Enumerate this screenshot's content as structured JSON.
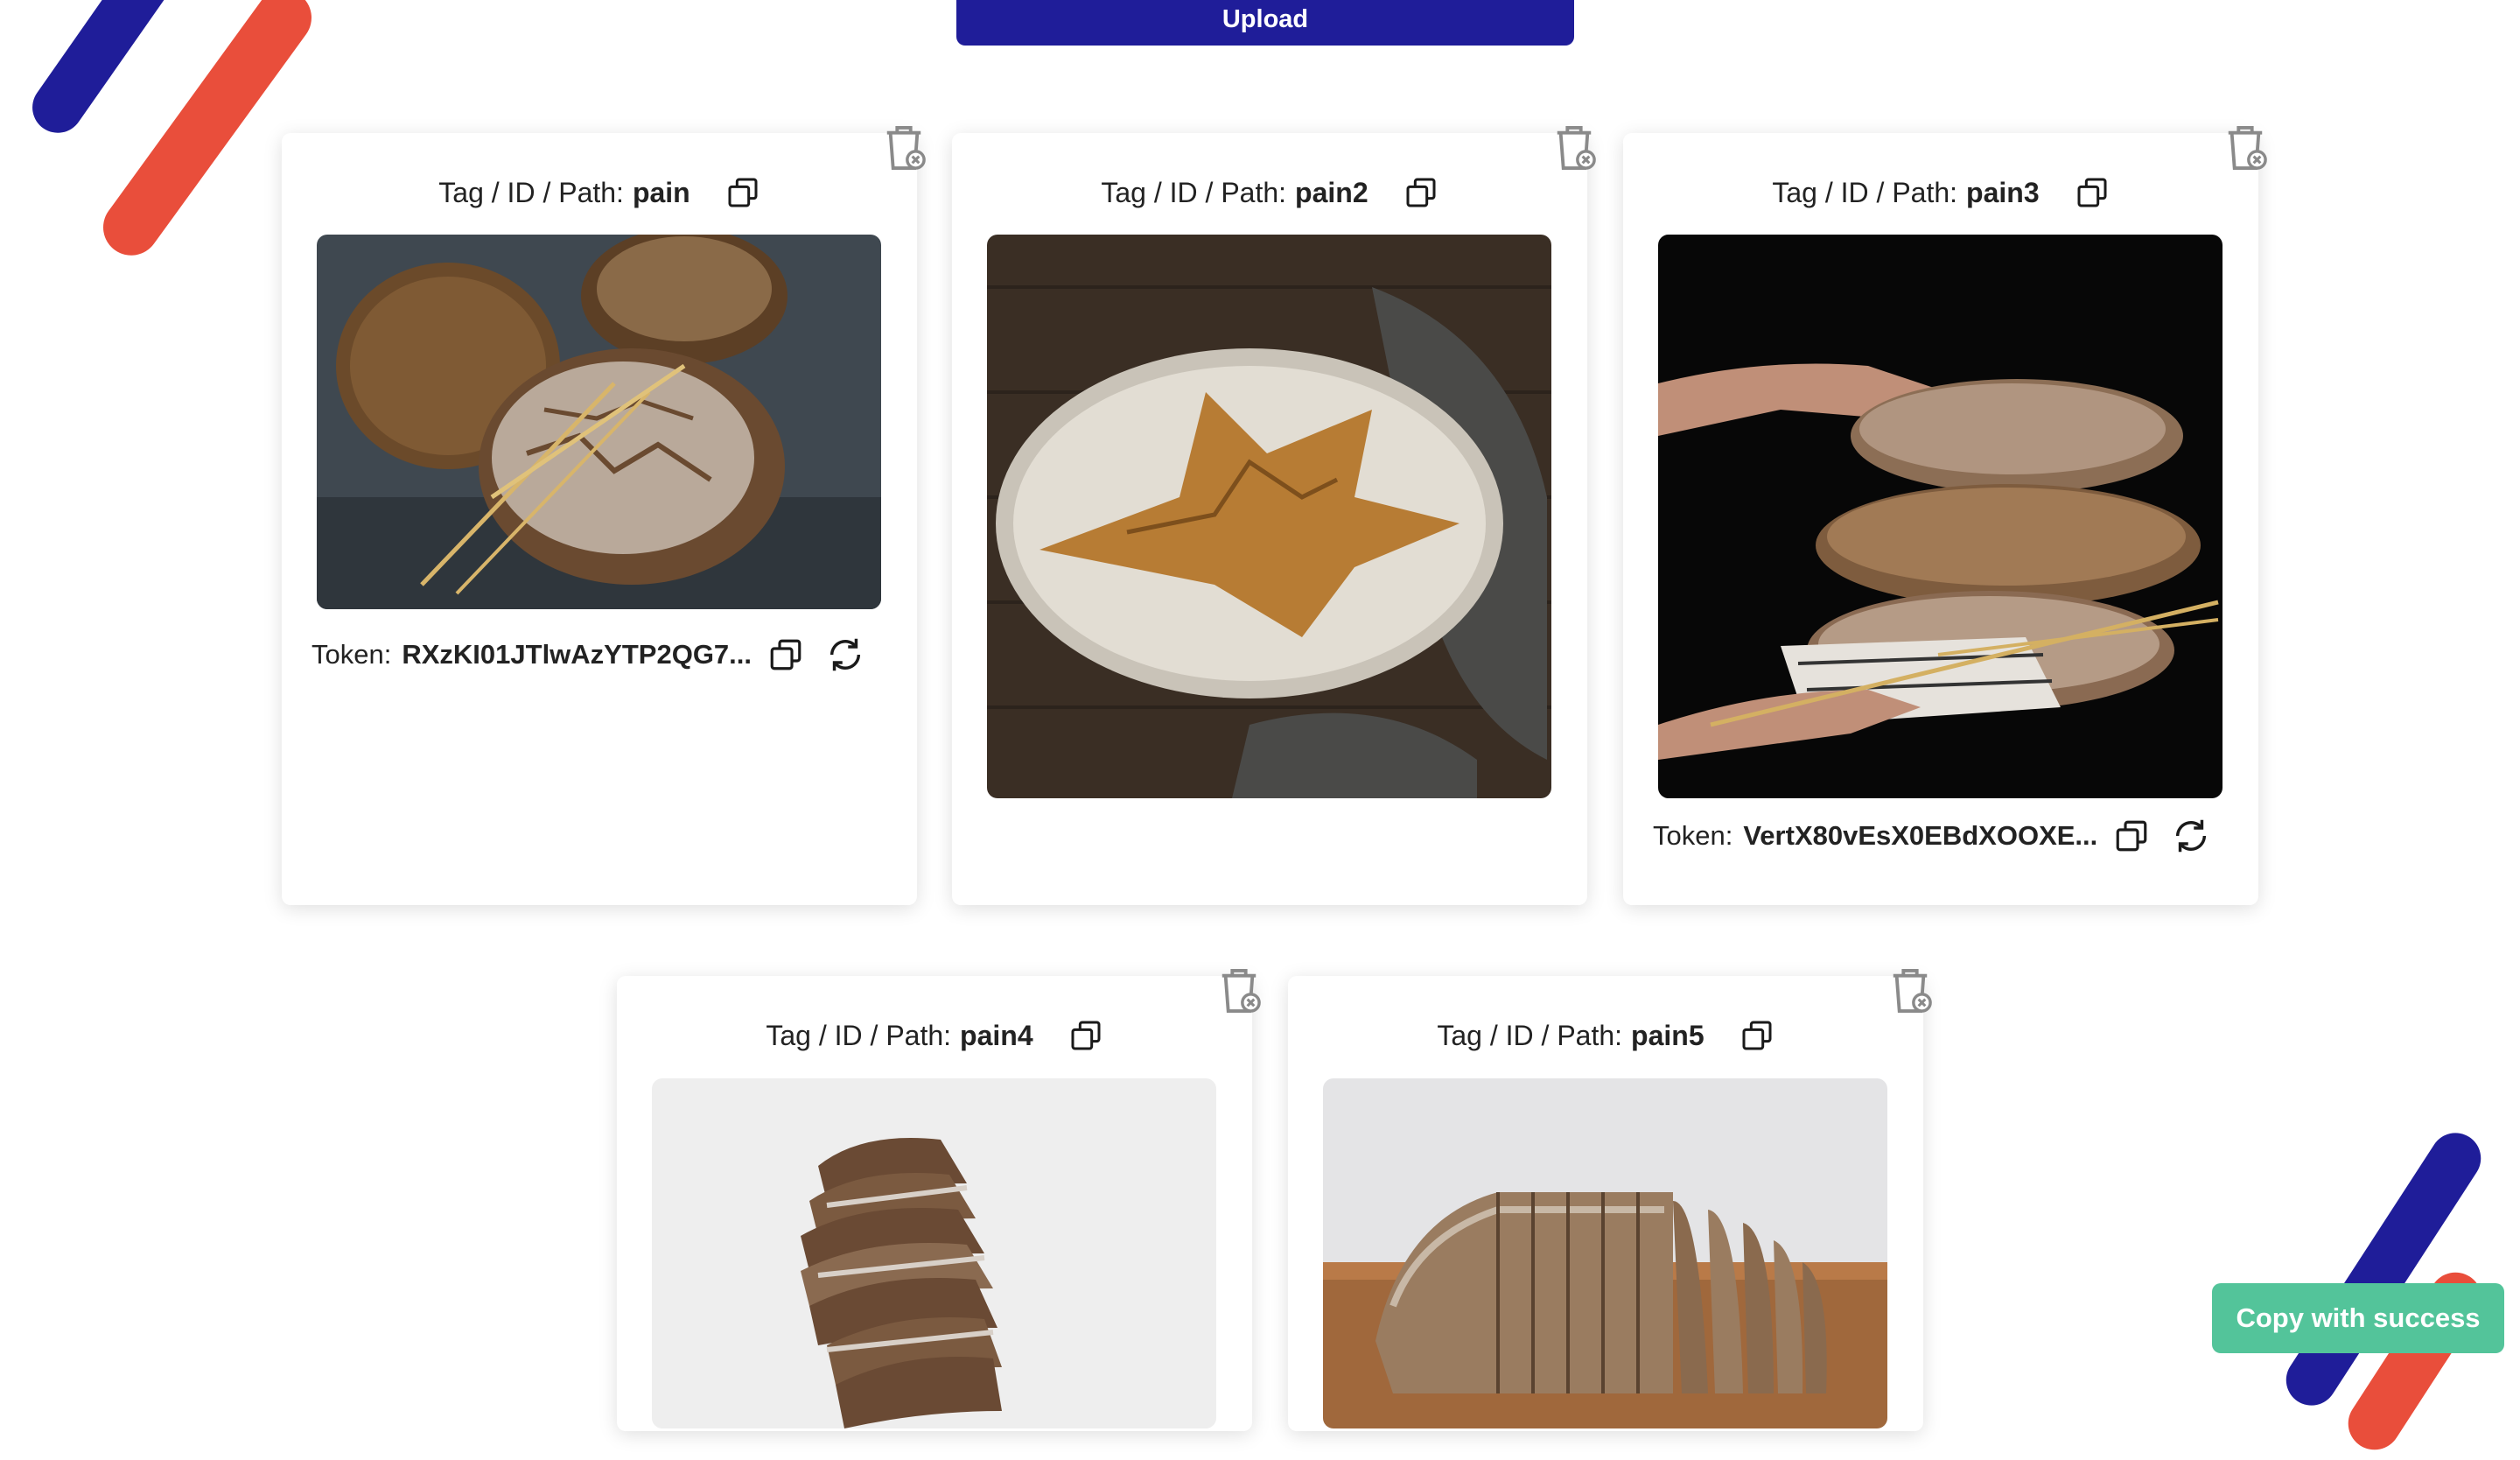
{
  "header": {
    "upload_label": "Upload"
  },
  "theme": {
    "accent_blue": "#1f1d99",
    "accent_red": "#e94e3b",
    "toast_green": "#53c49a"
  },
  "cards": [
    {
      "tag_label": "Tag / ID / Path:",
      "tag_value": "pain",
      "image": "bread-loaves-with-wheat-photo",
      "token_label": "Token:",
      "token_value": "RXzKI01JTlwAzYTP2QG7..."
    },
    {
      "tag_label": "Tag / ID / Path:",
      "tag_value": "pain2",
      "image": "round-sourdough-loaf-photo"
    },
    {
      "tag_label": "Tag / ID / Path:",
      "tag_value": "pain3",
      "image": "hands-holding-stacked-loaves-photo",
      "token_label": "Token:",
      "token_value": "VertX80vEsX0EBdXOOXE..."
    },
    {
      "tag_label": "Tag / ID / Path:",
      "tag_value": "pain4",
      "image": "sliced-rye-bread-photo"
    },
    {
      "tag_label": "Tag / ID / Path:",
      "tag_value": "pain5",
      "image": "sliced-loaf-on-board-photo"
    }
  ],
  "icons": {
    "copy": "copy-icon",
    "delete": "trash-icon",
    "refresh": "refresh-icon"
  },
  "toast": {
    "message": "Copy with success"
  }
}
